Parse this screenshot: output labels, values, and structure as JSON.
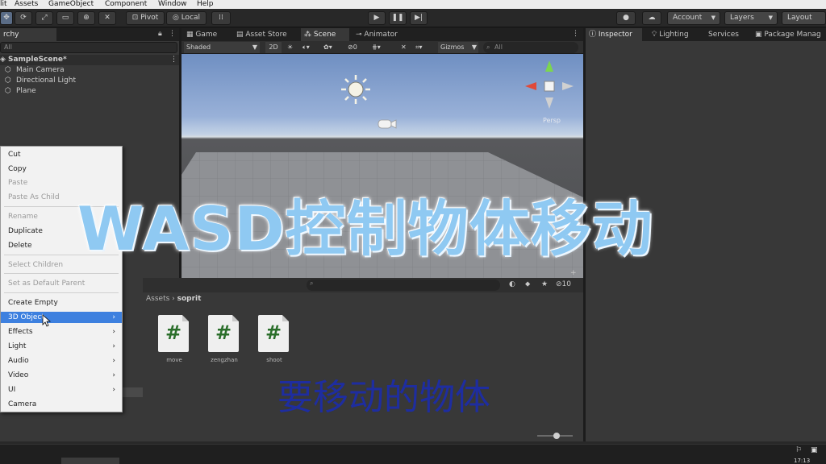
{
  "menubar": [
    "lit",
    "Assets",
    "GameObject",
    "Component",
    "Window",
    "Help"
  ],
  "toolbar": {
    "pivot_label": "Pivot",
    "local_label": "Local",
    "account_label": "Account",
    "layers_label": "Layers",
    "layout_label": "Layout"
  },
  "hierarchy": {
    "tab_label": "rchy",
    "search_placeholder": "All",
    "scene_name": "SampleScene*",
    "items": [
      "Main Camera",
      "Directional Light",
      "Plane"
    ]
  },
  "center_tabs": [
    "Game",
    "Asset Store",
    "Scene",
    "Animator"
  ],
  "scene_toolbar": {
    "shading_mode": "Shaded",
    "mode_2d": "2D",
    "hidden_count": "0",
    "gizmos_label": "Gizmos",
    "search_placeholder": "All"
  },
  "gizmo": {
    "projection_label": "Persp"
  },
  "right_tabs": [
    "Inspector",
    "Lighting",
    "Services",
    "Package Manag"
  ],
  "context_menu": {
    "items": [
      {
        "label": "Cut",
        "enabled": true
      },
      {
        "label": "Copy",
        "enabled": true
      },
      {
        "label": "Paste",
        "enabled": false
      },
      {
        "label": "Paste As Child",
        "enabled": false
      },
      {
        "label": "Rename",
        "enabled": false
      },
      {
        "label": "Duplicate",
        "enabled": true
      },
      {
        "label": "Delete",
        "enabled": true
      },
      {
        "label": "Select Children",
        "enabled": false
      },
      {
        "label": "Set as Default Parent",
        "enabled": false
      },
      {
        "label": "Create Empty",
        "enabled": true
      },
      {
        "label": "3D Object",
        "enabled": true,
        "submenu": true,
        "highlighted": true
      },
      {
        "label": "Effects",
        "enabled": true,
        "submenu": true
      },
      {
        "label": "Light",
        "enabled": true,
        "submenu": true
      },
      {
        "label": "Audio",
        "enabled": true,
        "submenu": true
      },
      {
        "label": "Video",
        "enabled": true,
        "submenu": true
      },
      {
        "label": "UI",
        "enabled": true,
        "submenu": true
      },
      {
        "label": "Camera",
        "enabled": true
      }
    ]
  },
  "project": {
    "breadcrumb_root": "Assets",
    "breadcrumb_folder": "soprit",
    "hidden_count": "10",
    "files": [
      {
        "icon": "csharp-script-icon",
        "glyph": "#",
        "name": "move"
      },
      {
        "icon": "csharp-script-icon",
        "glyph": "#",
        "name": "zengzhan"
      },
      {
        "icon": "csharp-script-icon",
        "glyph": "#",
        "name": "shoot"
      }
    ]
  },
  "overlay": {
    "title": "WASD控制物体移动",
    "subtitle": "要移动的物体"
  },
  "taskbar": {
    "clock": "17:13"
  }
}
